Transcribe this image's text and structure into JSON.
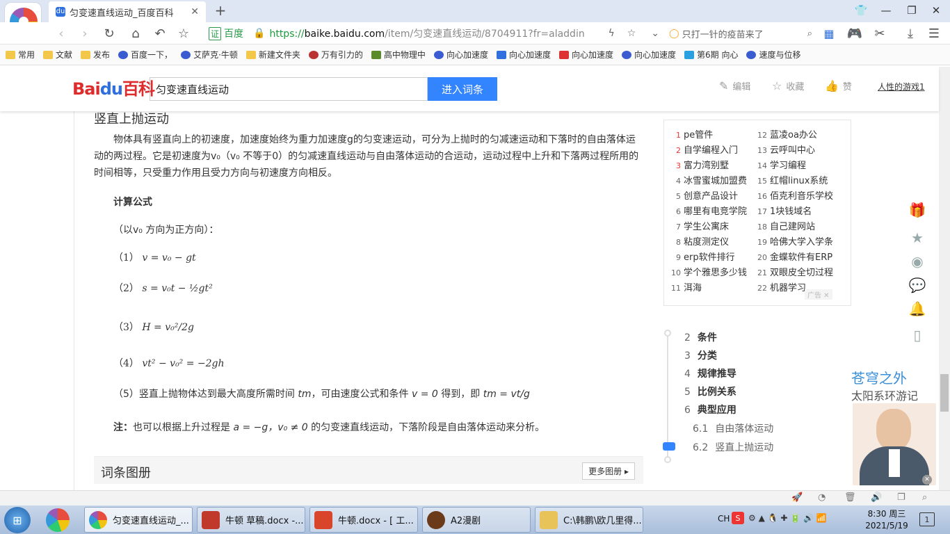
{
  "browser": {
    "tab_title": "匀变速直线运动_百度百科",
    "tab_favicon": "du",
    "url_prefix": "https://",
    "url_host": "baike.baidu.com",
    "url_path": "/item/匀变速直线运动/8704911?fr=aladdin",
    "cert_label": "证",
    "cert_text": "百度",
    "search_placeholder": "只打一针的疫苗来了",
    "bookmarks": [
      "常用",
      "文献",
      "发布",
      "百度一下，",
      "艾萨克·牛顿",
      "新建文件夹",
      "万有引力的",
      "高中物理中",
      "向心加速度",
      "向心加速度",
      "向心加速度",
      "向心加速度",
      "第6期 向心",
      "速度与位移"
    ]
  },
  "baike_header": {
    "logo_a": "Bai",
    "logo_b": "du",
    "logo_c": "百科",
    "search_value": "匀变速直线运动",
    "search_button": "进入词条",
    "edit": "编辑",
    "collect": "收藏",
    "like": "赞",
    "user": "人性的游戏1"
  },
  "article": {
    "section_title": "竖直上抛运动",
    "para1_line1": "物体具有竖直向上的初速度，加速度始终为重力加速度g的匀变速运动，可分为上抛时的匀减速运动和下落时的自由落体运",
    "para1_line2": "动的两过程。它是初速度为v₀（v₀ 不等于0）的匀减速直线运动与自由落体运动的合运动，运动过程中上升和下落两过程所用的",
    "para1_line3": "时间相等，只受重力作用且受力方向与初速度方向相反。",
    "formula_heading": "计算公式",
    "direction_note": "（以v₀ 方向为正方向）：",
    "eq1_num": "（1）",
    "eq1": "v = v₀ − gt",
    "eq2_num": "（2）",
    "eq2": "s = v₀t − ½gt²",
    "eq3_num": "（3）",
    "eq3": "H = v₀²/2g",
    "eq4_num": "（4）",
    "eq4": "vt² − v₀² = −2gh",
    "eq5_num": "（5）",
    "eq5_text_a": "竖直上抛物体达到最大高度所需时间",
    "eq5_tm": "tm",
    "eq5_text_b": "，可由速度公式和条件",
    "eq5_cond": "v = 0",
    "eq5_text_c": "得到，即",
    "eq5_result": "tm = vt/g",
    "note_prefix": "注：",
    "note_a": "也可以根据上升过程是",
    "note_formula": "a = −g，v₀ ≠ 0",
    "note_b": "的匀变速直线运动，下落阶段是自由落体运动来分析。",
    "gallery_title": "词条图册",
    "gallery_more": "更多图册"
  },
  "ads": {
    "left": [
      {
        "n": "1",
        "t": "pe管件"
      },
      {
        "n": "2",
        "t": "自学编程入门"
      },
      {
        "n": "3",
        "t": "富力湾别墅"
      },
      {
        "n": "4",
        "t": "冰雪蜜城加盟费"
      },
      {
        "n": "5",
        "t": "创意产品设计"
      },
      {
        "n": "6",
        "t": "哪里有电竞学院"
      },
      {
        "n": "7",
        "t": "学生公寓床"
      },
      {
        "n": "8",
        "t": "粘度测定仪"
      },
      {
        "n": "9",
        "t": "erp软件排行"
      },
      {
        "n": "10",
        "t": "学个雅思多少钱"
      },
      {
        "n": "11",
        "t": "洱海"
      }
    ],
    "right": [
      {
        "n": "12",
        "t": "蓝凌oa办公"
      },
      {
        "n": "13",
        "t": "云呼叫中心"
      },
      {
        "n": "14",
        "t": "学习编程"
      },
      {
        "n": "15",
        "t": "红帽linux系统"
      },
      {
        "n": "16",
        "t": "佰克利音乐学校"
      },
      {
        "n": "17",
        "t": "1块钱域名"
      },
      {
        "n": "18",
        "t": "自己建网站"
      },
      {
        "n": "19",
        "t": "哈佛大学入学条"
      },
      {
        "n": "20",
        "t": "金蝶软件有ERP"
      },
      {
        "n": "21",
        "t": "双眼皮全切过程"
      },
      {
        "n": "22",
        "t": "机器学习"
      }
    ],
    "ad_tag": "广告"
  },
  "toc": [
    {
      "n": "2",
      "t": "条件"
    },
    {
      "n": "3",
      "t": "分类"
    },
    {
      "n": "4",
      "t": "规律推导"
    },
    {
      "n": "5",
      "t": "比例关系"
    },
    {
      "n": "6",
      "t": "典型应用"
    },
    {
      "n": "6.1",
      "t": "自由落体运动"
    },
    {
      "n": "6.2",
      "t": "竖直上抛运动"
    }
  ],
  "side_ad": {
    "line1": "苍穹之外",
    "line2": "太阳系环游记"
  },
  "taskbar": {
    "tasks": [
      "匀变速直线运动_...",
      "牛顿 草稿.docx -...",
      "牛顿.docx - [ 工...",
      "A2漫剧",
      "C:\\韩鹏\\欧几里得..."
    ],
    "ime": "CH",
    "time": "8:30 周三",
    "date": "2021/5/19"
  },
  "colors": {
    "baidu_blue": "#3385ff",
    "baidu_red": "#de2c2c",
    "ad_number_red": "#ee3333",
    "toc_active": "#3385ff"
  }
}
